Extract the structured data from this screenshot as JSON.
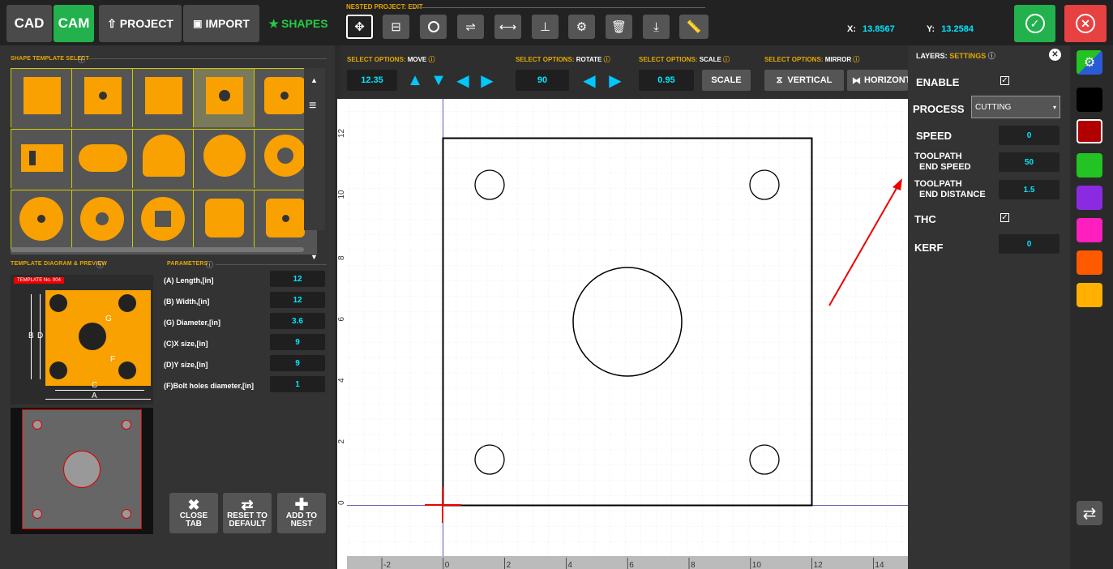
{
  "topbar": {
    "cad": "CAD",
    "cam": "CAM",
    "project": "PROJECT",
    "import": "IMPORT",
    "shapes": "SHAPES",
    "nested_label": "NESTED PROJECT: EDIT",
    "x_label": "X:",
    "x_value": "13.8567",
    "y_label": "Y:",
    "y_value": "13.2584"
  },
  "left": {
    "shape_select_title": "SHAPE TEMPLATE SELECT",
    "diagram_title": "TEMPLATE DIAGRAM & PREVIEW",
    "template_no": "TEMPLATE No. 004",
    "params_title": "PARAMETERS",
    "params": [
      {
        "label": "(A) Length,[in]",
        "value": "12"
      },
      {
        "label": "(B) Width,[in]",
        "value": "12"
      },
      {
        "label": "(G) Diameter,[in]",
        "value": "3.6"
      },
      {
        "label": "(C)X size,[in]",
        "value": "9"
      },
      {
        "label": "(D)Y size,[in]",
        "value": "9"
      },
      {
        "label": "(F)Bolt holes diameter,[in]",
        "value": "1"
      }
    ],
    "diagram_letters": {
      "a": "A",
      "b": "B",
      "c": "C",
      "d": "D",
      "f": "F",
      "g": "G"
    },
    "buttons": {
      "close1": "CLOSE",
      "close2": "TAB",
      "reset1": "RESET TO",
      "reset2": "DEFAULT",
      "add1": "ADD TO",
      "add2": "NEST"
    }
  },
  "options": {
    "move_label": "SELECT OPTIONS:",
    "move_kind": "MOVE",
    "move_value": "12.35",
    "rotate_label": "SELECT OPTIONS:",
    "rotate_kind": "ROTATE",
    "rotate_value": "90",
    "scale_label": "SELECT OPTIONS:",
    "scale_kind": "SCALE",
    "scale_value": "0.95",
    "scale_btn": "SCALE",
    "mirror_label": "SELECT OPTIONS:",
    "mirror_kind": "MIRROR",
    "vertical": "VERTICAL",
    "horizontal": "HORIZONT"
  },
  "canvas": {
    "y_ticks": [
      "12",
      "10",
      "8",
      "6",
      "4",
      "2",
      "0"
    ],
    "x_ticks": [
      "-2",
      "0",
      "2",
      "4",
      "6",
      "8",
      "10",
      "12",
      "14"
    ]
  },
  "layers": {
    "title": "LAYERS:",
    "title_kind": "SETTINGS",
    "enable": "ENABLE",
    "process": "PROCESS",
    "process_value": "CUTTING",
    "speed": "SPEED",
    "speed_value": "0",
    "tp_end_speed1": "TOOLPATH",
    "tp_end_speed2": "END SPEED",
    "tp_end_speed_value": "50",
    "tp_end_dist1": "TOOLPATH",
    "tp_end_dist2": "END DISTANCE",
    "tp_end_dist_value": "1.5",
    "thc": "THC",
    "kerf": "KERF",
    "kerf_value": "0"
  },
  "colors": {
    "accent": "#00e6ff",
    "orange": "#f8a100",
    "title": "#e6a800",
    "swatches": [
      "#000000",
      "#b00000",
      "#22c322",
      "#8a2be2",
      "#ff1fbf",
      "#ff5a00",
      "#ffb000"
    ]
  }
}
